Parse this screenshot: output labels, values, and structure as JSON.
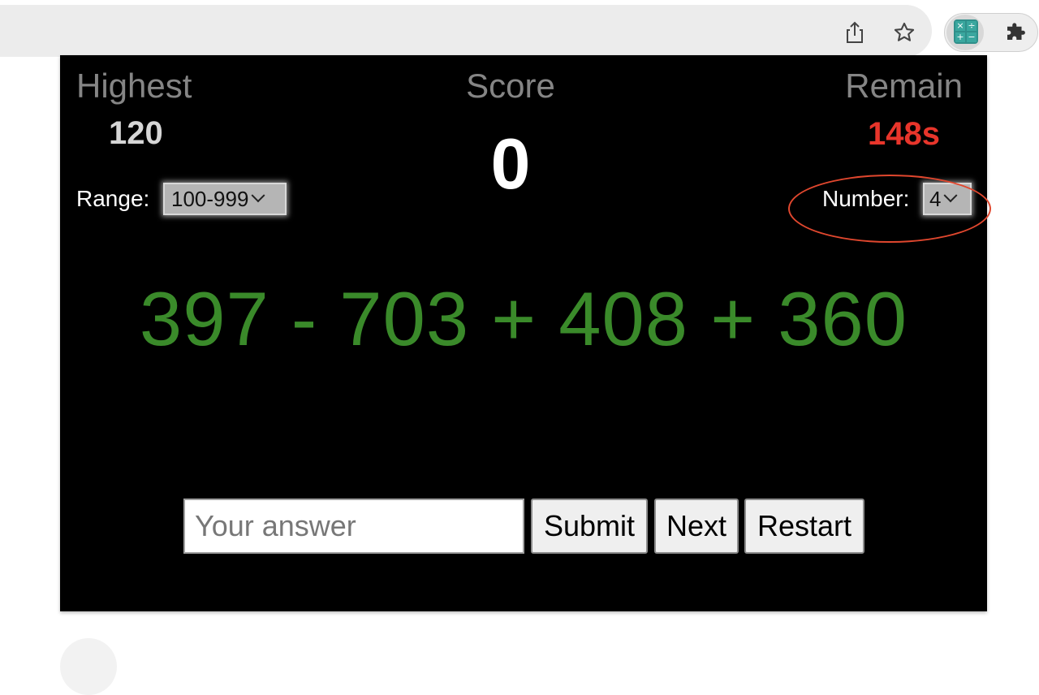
{
  "browser": {
    "toolbar_icons": [
      "share-icon",
      "star-icon",
      "calculator-extension-icon",
      "puzzle-extension-icon"
    ],
    "extension_glyphs": [
      "×",
      "÷",
      "+",
      "−"
    ]
  },
  "game": {
    "labels": {
      "highest": "Highest",
      "score": "Score",
      "remain": "Remain",
      "range": "Range:",
      "number": "Number:"
    },
    "values": {
      "highest": "120",
      "score": "0",
      "remain": "148s"
    },
    "settings": {
      "range_selected": "100-999",
      "number_selected": "4"
    },
    "expression": "397 - 703 + 408 + 360",
    "answer": {
      "placeholder": "Your answer",
      "value": ""
    },
    "buttons": {
      "submit": "Submit",
      "next": "Next",
      "restart": "Restart"
    },
    "colors": {
      "background": "#000000",
      "expression": "#3a8a2a",
      "remain": "#e8352b",
      "highlight_ring": "#e0472e"
    }
  }
}
